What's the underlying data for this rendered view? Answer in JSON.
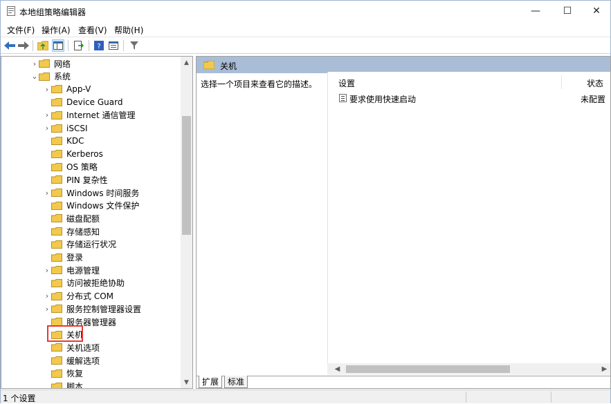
{
  "window": {
    "title": "本地组策略编辑器"
  },
  "window_controls": {
    "minimize": "—",
    "maximize": "☐",
    "close": "✕"
  },
  "menu": [
    "文件(F)",
    "操作(A)",
    "查看(V)",
    "帮助(H)"
  ],
  "toolbar": {
    "items": [
      "back-arrow-icon",
      "forward-arrow-icon",
      "up-folder-icon",
      "show-hide-tree-icon",
      "export-list-icon",
      "help-icon",
      "properties-icon",
      "filter-icon"
    ]
  },
  "tree": {
    "items": [
      {
        "label": "网络",
        "expander": "›",
        "indent": 0
      },
      {
        "label": "系统",
        "expander": "⌄",
        "indent": 0
      },
      {
        "label": "App-V",
        "expander": "›",
        "indent": 1
      },
      {
        "label": "Device Guard",
        "expander": "",
        "indent": 1
      },
      {
        "label": "Internet 通信管理",
        "expander": "›",
        "indent": 1
      },
      {
        "label": "iSCSI",
        "expander": "›",
        "indent": 1
      },
      {
        "label": "KDC",
        "expander": "",
        "indent": 1
      },
      {
        "label": "Kerberos",
        "expander": "",
        "indent": 1
      },
      {
        "label": "OS 策略",
        "expander": "",
        "indent": 1
      },
      {
        "label": "PIN 复杂性",
        "expander": "",
        "indent": 1
      },
      {
        "label": "Windows 时间服务",
        "expander": "›",
        "indent": 1
      },
      {
        "label": "Windows 文件保护",
        "expander": "",
        "indent": 1
      },
      {
        "label": "磁盘配额",
        "expander": "",
        "indent": 1
      },
      {
        "label": "存储感知",
        "expander": "",
        "indent": 1
      },
      {
        "label": "存储运行状况",
        "expander": "",
        "indent": 1
      },
      {
        "label": "登录",
        "expander": "",
        "indent": 1
      },
      {
        "label": "电源管理",
        "expander": "›",
        "indent": 1
      },
      {
        "label": "访问被拒绝协助",
        "expander": "",
        "indent": 1
      },
      {
        "label": "分布式 COM",
        "expander": "›",
        "indent": 1
      },
      {
        "label": "服务控制管理器设置",
        "expander": "›",
        "indent": 1
      },
      {
        "label": "服务器管理器",
        "expander": "",
        "indent": 1
      },
      {
        "label": "关机",
        "expander": "",
        "indent": 1
      },
      {
        "label": "关机选项",
        "expander": "",
        "indent": 1
      },
      {
        "label": "缓解选项",
        "expander": "",
        "indent": 1
      },
      {
        "label": "恢复",
        "expander": "",
        "indent": 1
      },
      {
        "label": "脚本",
        "expander": "",
        "indent": 1
      }
    ],
    "scroll_up": "▲",
    "scroll_down": "▼"
  },
  "right_pane": {
    "header": "关机",
    "description": "选择一个项目来查看它的描述。",
    "columns": {
      "setting": "设置",
      "state": "状态"
    },
    "rows": [
      {
        "name": "要求使用快速启动",
        "state": "未配置"
      }
    ],
    "scroll_left": "◀",
    "scroll_right": "▶",
    "tabs": [
      "扩展",
      "标准"
    ]
  },
  "status": {
    "text": "1 个设置"
  },
  "colors": {
    "header_bg": "#a9bdd6",
    "highlight_border": "#e53935",
    "folder": "#f2c94c"
  }
}
